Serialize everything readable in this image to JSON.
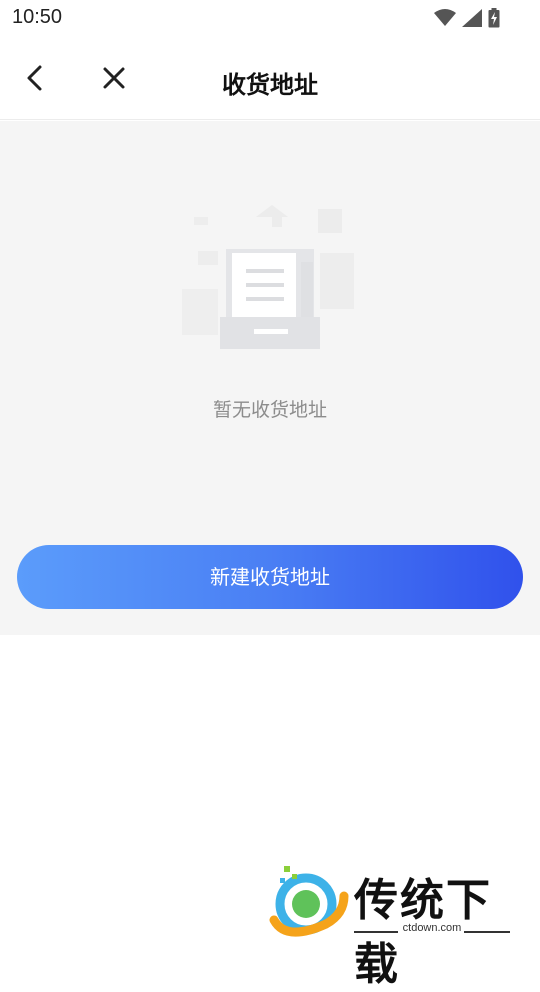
{
  "status_bar": {
    "time": "10:50",
    "icons": [
      "wifi-icon",
      "cellular-signal-icon",
      "battery-charging-icon"
    ]
  },
  "nav": {
    "title": "收货地址",
    "back_icon": "chevron-left-icon",
    "close_icon": "close-icon"
  },
  "empty_state": {
    "illustration": "empty-document-box-icon",
    "text": "暂无收货地址"
  },
  "actions": {
    "new_address_label": "新建收货地址"
  },
  "watermark": {
    "brand": "传统下载",
    "domain": "ctdown.com"
  },
  "colors": {
    "button_gradient_start": "#5b9cfb",
    "button_gradient_end": "#3051ec",
    "content_background": "#f5f5f5",
    "empty_text": "#8c8c8c"
  }
}
